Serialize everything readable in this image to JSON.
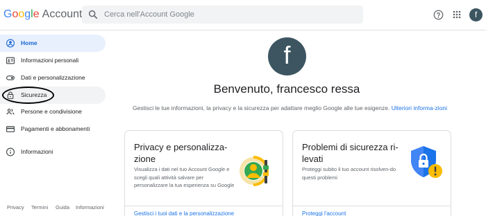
{
  "header": {
    "logo_letters": [
      "G",
      "o",
      "o",
      "g",
      "l",
      "e"
    ],
    "logo_suffix": "Account",
    "search_placeholder": "Cerca nell'Account Google",
    "avatar_initial": "f"
  },
  "sidebar": {
    "items": [
      {
        "label": "Home",
        "icon": "person-circle-icon"
      },
      {
        "label": "Informazioni personali",
        "icon": "id-card-icon"
      },
      {
        "label": "Dati e personalizzazione",
        "icon": "toggle-icon"
      },
      {
        "label": "Sicurezza",
        "icon": "lock-icon"
      },
      {
        "label": "Persone e condivisione",
        "icon": "people-icon"
      },
      {
        "label": "Pagamenti e abbonamenti",
        "icon": "credit-card-icon"
      },
      {
        "label": "Informazioni",
        "icon": "info-icon"
      }
    ],
    "footer": [
      "Privacy",
      "Termini",
      "Guida",
      "Informazioni"
    ]
  },
  "main": {
    "avatar_initial": "f",
    "welcome": "Benvenuto, francesco ressa",
    "intro_text": "Gestisci le tue informazioni, la privacy e la sicurezza per adattare meglio Google alle tue esigenze.",
    "intro_link": "Ulteriori informa-zioni",
    "cards": [
      {
        "title": "Privacy e personalizza-zione",
        "description": "Visualizza i dati nel tuo Account Google e scegli quali attività salvare per personalizzare la tua esperienza su Google",
        "link": "Gestisci i tuoi dati e la personalizzazione"
      },
      {
        "title": "Problemi di sicurezza ri-levati",
        "description": "Proteggi subito il tuo account risolven-do questi problemi",
        "link": "Proteggi l'account"
      }
    ]
  },
  "colors": {
    "accent": "#1a73e8",
    "active_bg": "#e8f0fe",
    "avatar_bg": "#3c5561",
    "shield_blue": "#1a73e8",
    "warning_yellow": "#fbbc04"
  }
}
